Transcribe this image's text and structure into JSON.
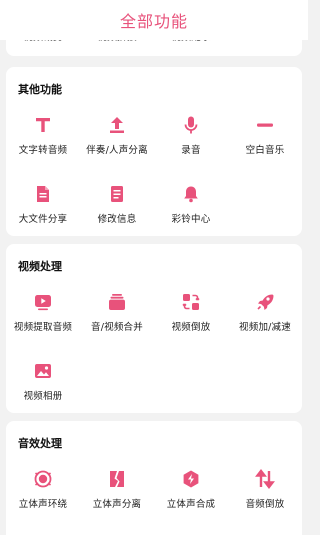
{
  "header": {
    "title": "全部功能"
  },
  "peek_labels": [
    "视频裁剪",
    "视频拼接",
    "视频配乐"
  ],
  "accent": "#e8527b",
  "sections": [
    {
      "title": "其他功能",
      "items": [
        {
          "label": "文字转音频",
          "icon": "text-icon"
        },
        {
          "label": "伴奏/人声分离",
          "icon": "upload-icon"
        },
        {
          "label": "录音",
          "icon": "microphone-icon"
        },
        {
          "label": "空白音乐",
          "icon": "minus-icon"
        },
        {
          "label": "大文件分享",
          "icon": "file-icon"
        },
        {
          "label": "修改信息",
          "icon": "document-icon"
        },
        {
          "label": "彩铃中心",
          "icon": "bell-icon"
        }
      ]
    },
    {
      "title": "视频处理",
      "items": [
        {
          "label": "视频提取音频",
          "icon": "play-video-icon"
        },
        {
          "label": "音/视频合并",
          "icon": "stack-icon"
        },
        {
          "label": "视频倒放",
          "icon": "reverse-icon"
        },
        {
          "label": "视频加/减速",
          "icon": "rocket-icon"
        },
        {
          "label": "视频相册",
          "icon": "photo-icon"
        }
      ]
    },
    {
      "title": "音效处理",
      "items": [
        {
          "label": "立体声环绕",
          "icon": "surround-icon"
        },
        {
          "label": "立体声分离",
          "icon": "split-icon"
        },
        {
          "label": "立体声合成",
          "icon": "merge-icon"
        },
        {
          "label": "音频倒放",
          "icon": "swap-arrows-icon"
        }
      ]
    }
  ]
}
